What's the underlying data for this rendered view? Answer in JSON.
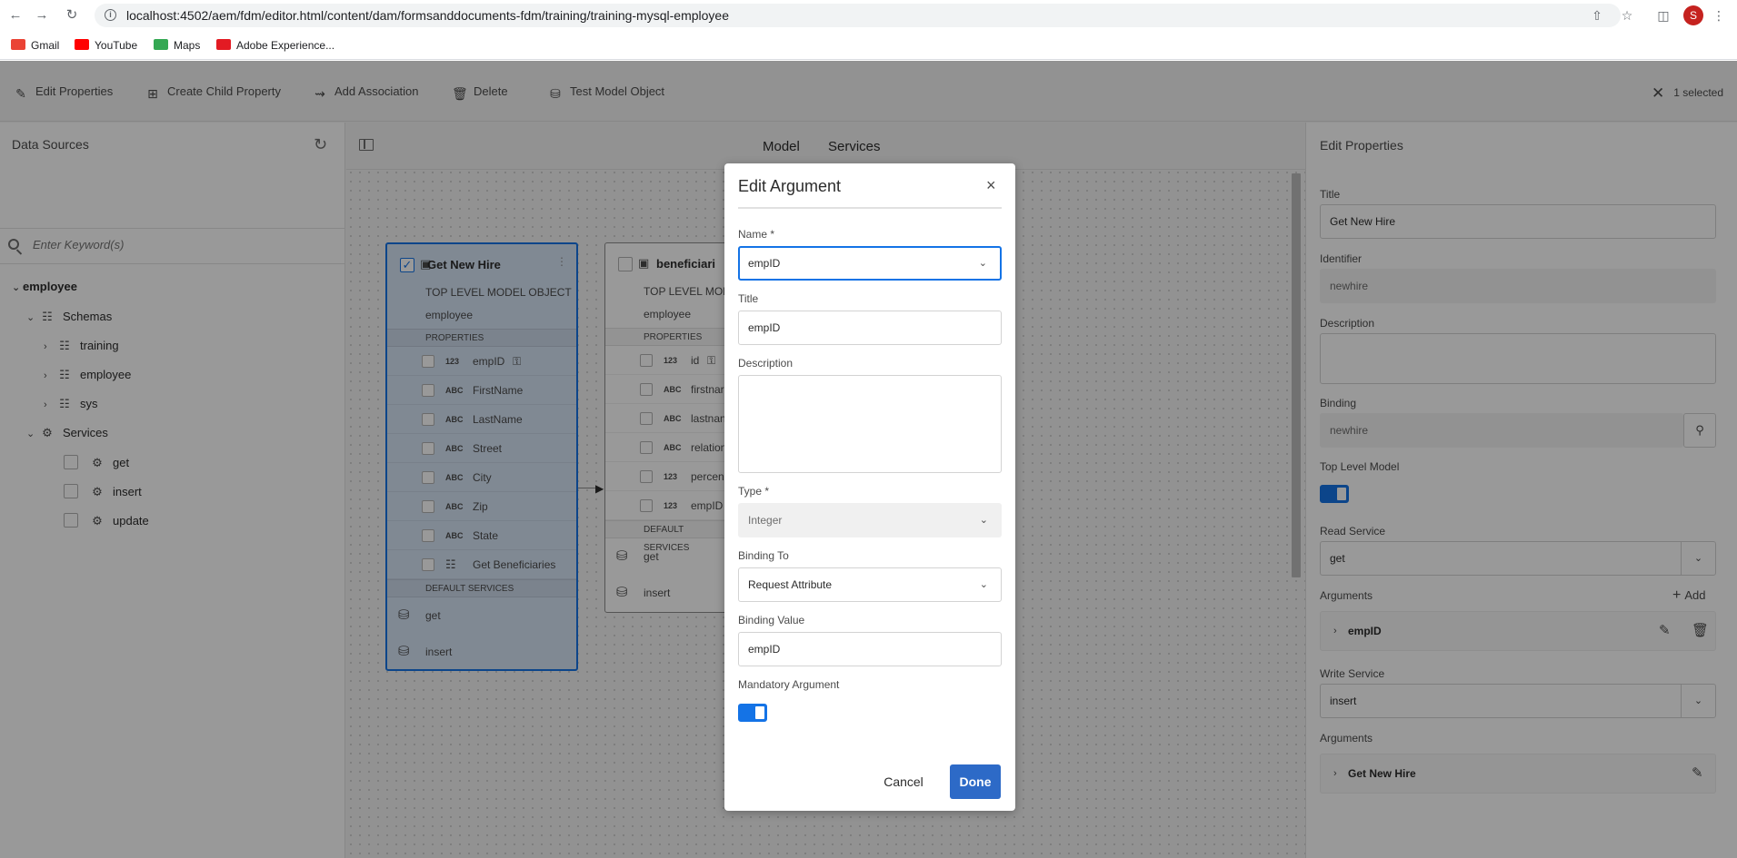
{
  "browser": {
    "url": "localhost:4502/aem/fdm/editor.html/content/dam/formsanddocuments-fdm/training/training-mysql-employee",
    "profile_initial": "S",
    "bookmarks": [
      {
        "label": "Gmail",
        "icon": "gmail-icon"
      },
      {
        "label": "YouTube",
        "icon": "youtube-icon"
      },
      {
        "label": "Maps",
        "icon": "maps-icon"
      },
      {
        "label": "Adobe Experience...",
        "icon": "adobe-icon"
      }
    ]
  },
  "toolbar": {
    "edit_properties": "Edit Properties",
    "create_child_property": "Create Child Property",
    "add_association": "Add Association",
    "delete": "Delete",
    "test_model_object": "Test Model Object",
    "selected_count": "1 selected"
  },
  "left_panel": {
    "title": "Data Sources",
    "search_placeholder": "Enter Keyword(s)",
    "root": "employee",
    "schemas_label": "Schemas",
    "schemas": [
      "training",
      "employee",
      "sys"
    ],
    "services_label": "Services",
    "services": [
      "get",
      "insert",
      "update"
    ]
  },
  "canvas": {
    "tabs": [
      "Model",
      "Services"
    ],
    "card1": {
      "title": "Get New Hire",
      "subtitle": "TOP LEVEL MODEL OBJECT",
      "source": "employee",
      "properties_label": "PROPERTIES",
      "properties": [
        {
          "type": "123",
          "name": "empID"
        },
        {
          "type": "ABC",
          "name": "FirstName"
        },
        {
          "type": "ABC",
          "name": "LastName"
        },
        {
          "type": "ABC",
          "name": "Street"
        },
        {
          "type": "ABC",
          "name": "City"
        },
        {
          "type": "ABC",
          "name": "Zip"
        },
        {
          "type": "ABC",
          "name": "State"
        },
        {
          "type": "",
          "name": "Get Beneficiaries"
        }
      ],
      "services_label": "DEFAULT SERVICES",
      "services": [
        "get",
        "insert"
      ]
    },
    "card2": {
      "title": "beneficiari",
      "subtitle": "TOP LEVEL MOD",
      "source": "employee",
      "properties_label": "PROPERTIES",
      "properties": [
        {
          "type": "123",
          "name": "id"
        },
        {
          "type": "ABC",
          "name": "firstnar"
        },
        {
          "type": "ABC",
          "name": "lastnan"
        },
        {
          "type": "ABC",
          "name": "relation"
        },
        {
          "type": "123",
          "name": "percen"
        },
        {
          "type": "123",
          "name": "empID"
        }
      ],
      "services_label": "DEFAULT SERVICES",
      "services": [
        "get",
        "insert"
      ]
    }
  },
  "right_panel": {
    "title": "Edit Properties",
    "title_label": "Title",
    "title_value": "Get New Hire",
    "identifier_label": "Identifier",
    "identifier_value": "newhire",
    "description_label": "Description",
    "binding_label": "Binding",
    "binding_value": "newhire",
    "top_level_label": "Top Level Model",
    "top_level_on": true,
    "read_service_label": "Read Service",
    "read_service_value": "get",
    "arguments_label": "Arguments",
    "add_label": "Add",
    "read_argument": "empID",
    "write_service_label": "Write Service",
    "write_service_value": "insert",
    "write_arguments_label": "Arguments",
    "write_argument": "Get New Hire"
  },
  "dialog": {
    "title": "Edit Argument",
    "name_label": "Name *",
    "name_value": "empID",
    "title_label": "Title",
    "title_value": "empID",
    "description_label": "Description",
    "type_label": "Type *",
    "type_value": "Integer",
    "binding_to_label": "Binding To",
    "binding_to_value": "Request Attribute",
    "binding_value_label": "Binding Value",
    "binding_value": "empID",
    "mandatory_label": "Mandatory Argument",
    "mandatory_on": true,
    "cancel": "Cancel",
    "done": "Done"
  },
  "colors": {
    "accent": "#1473e6",
    "done_button": "#2d6ac7",
    "selected_card": "#d6e4f6"
  }
}
